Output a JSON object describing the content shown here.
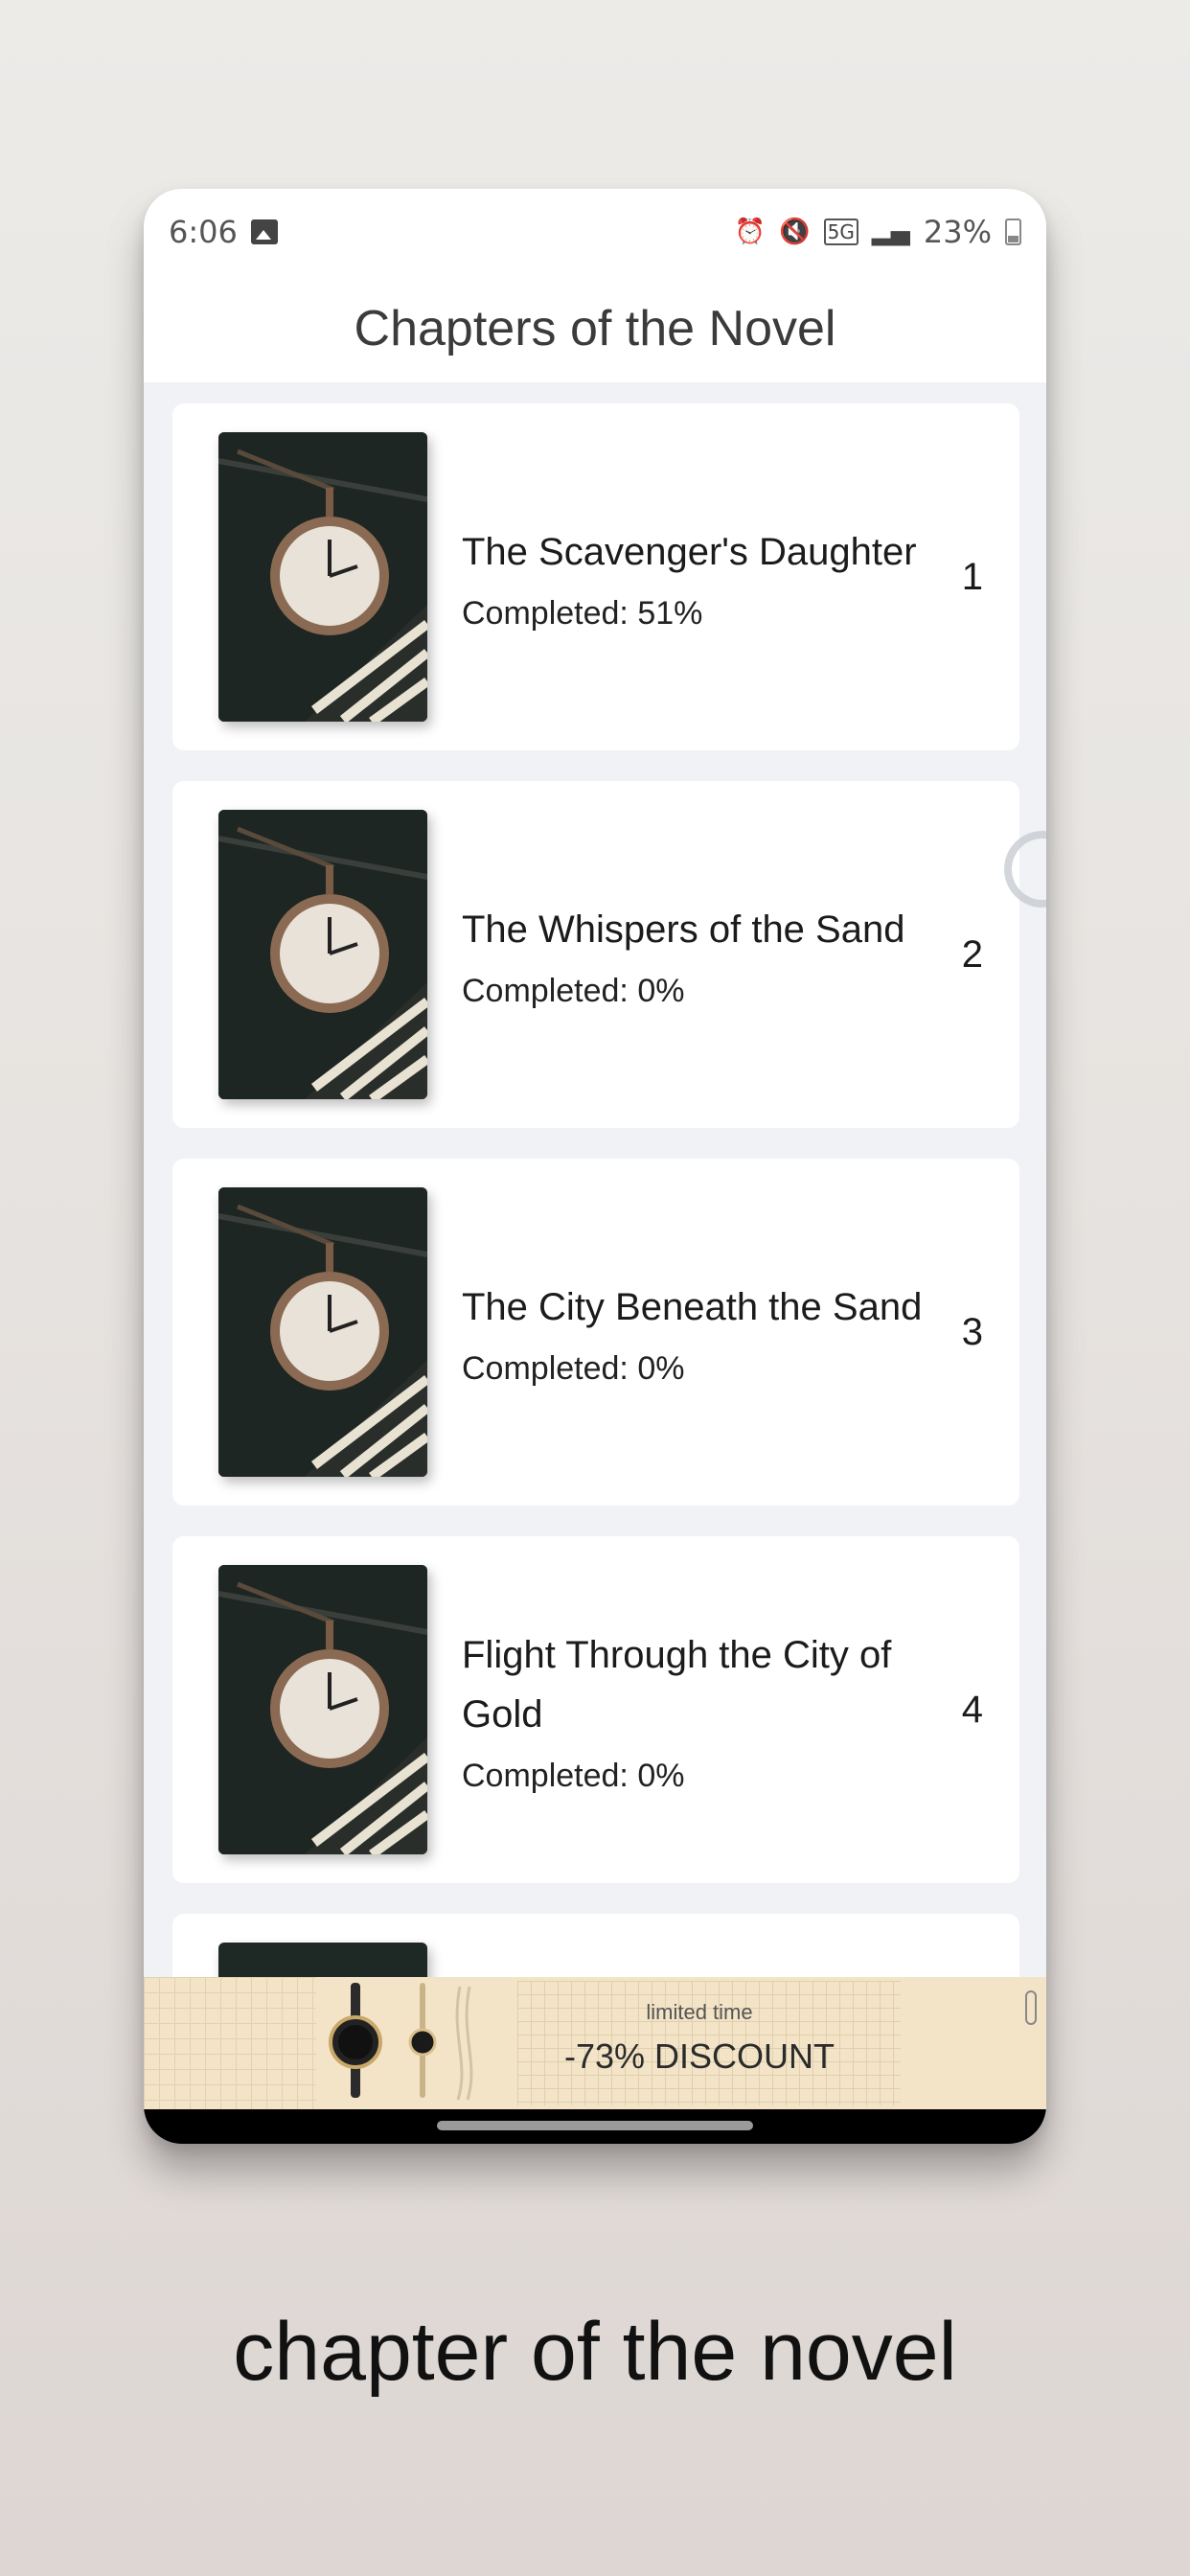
{
  "status_bar": {
    "time": "6:06",
    "network": "5G",
    "battery": "23%",
    "icons": [
      "image-icon",
      "alarm-icon",
      "mute-icon",
      "signal-icon",
      "battery-icon"
    ]
  },
  "header": {
    "title": "Chapters of the Novel"
  },
  "chapters": [
    {
      "title": "The Scavenger's Daughter",
      "progress": "Completed: 51%",
      "number": "1"
    },
    {
      "title": "The Whispers of the Sand",
      "progress": "Completed: 0%",
      "number": "2"
    },
    {
      "title": "The City Beneath the Sand",
      "progress": "Completed: 0%",
      "number": "3"
    },
    {
      "title": "Flight Through the City of Gold",
      "progress": "Completed: 0%",
      "number": "4"
    }
  ],
  "ad": {
    "tagline": "limited time",
    "headline": "-73% DISCOUNT"
  },
  "caption": "chapter of the novel"
}
